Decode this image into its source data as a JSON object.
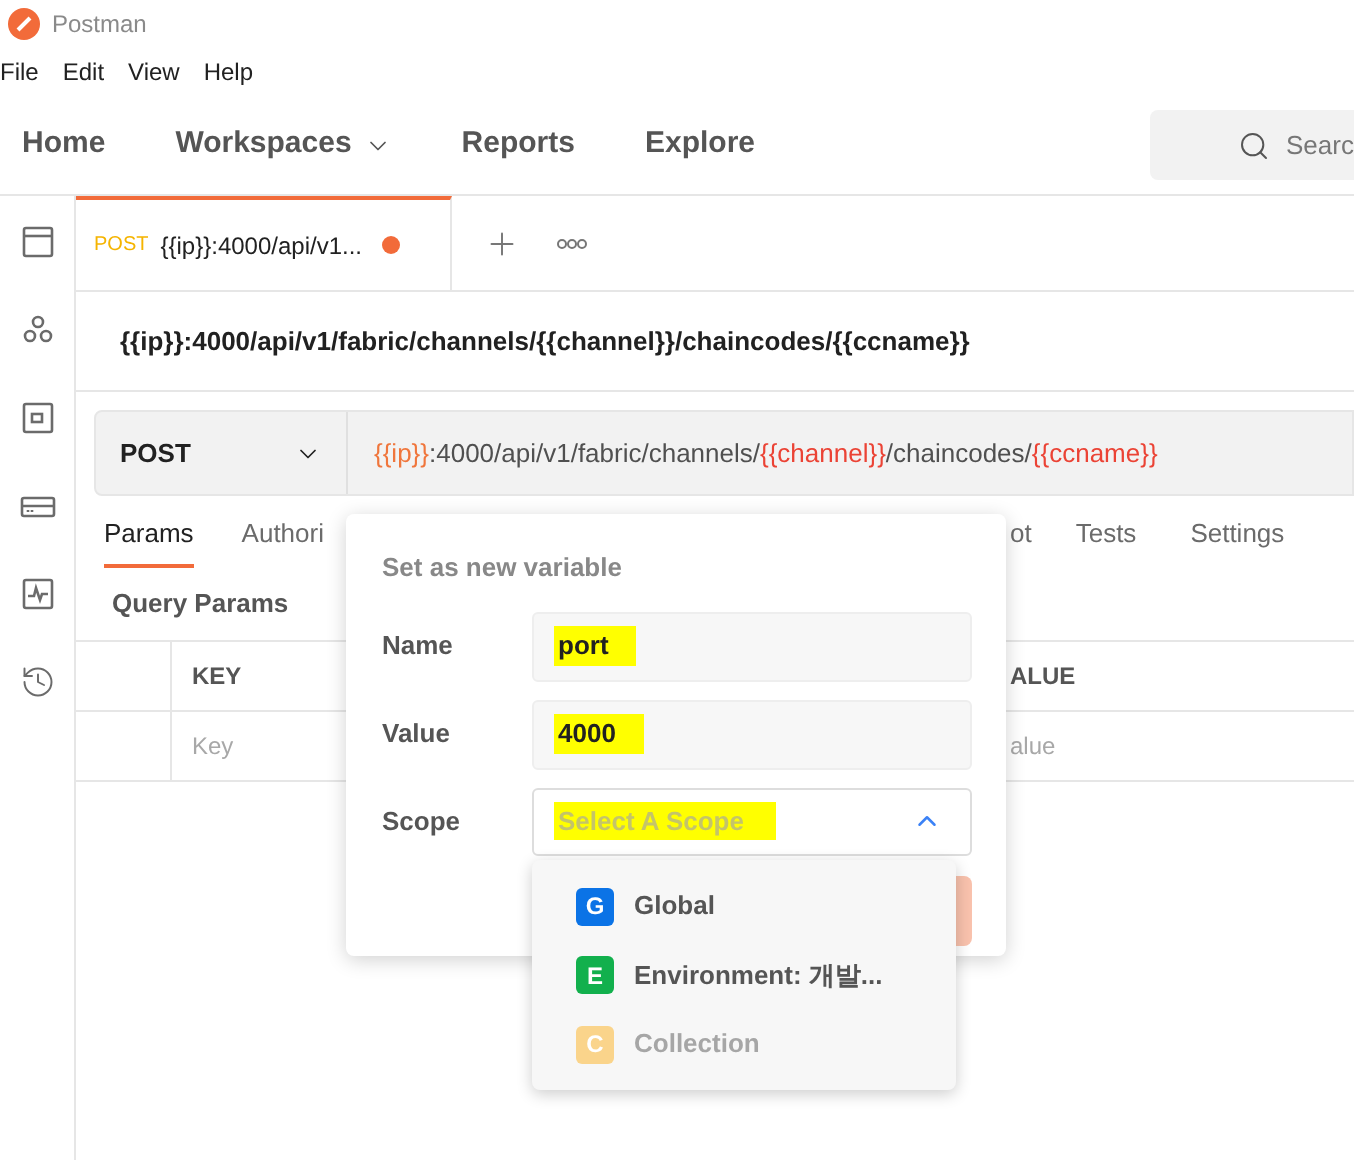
{
  "app": {
    "title": "Postman"
  },
  "menu": [
    "File",
    "Edit",
    "View",
    "Help"
  ],
  "nav": [
    {
      "label": "Home",
      "dropdown": false
    },
    {
      "label": "Workspaces",
      "dropdown": true
    },
    {
      "label": "Reports",
      "dropdown": false
    },
    {
      "label": "Explore",
      "dropdown": false
    }
  ],
  "search": {
    "placeholder": "Searc"
  },
  "request_tabs": [
    {
      "method": "POST",
      "title": "{{ip}}:4000/api/v1...",
      "unsaved": true,
      "selected": true
    }
  ],
  "request_title": "{{ip}}:4000/api/v1/fabric/channels/{{channel}}/chaincodes/{{ccname}}",
  "url_bar": {
    "method": "POST",
    "url_parts": [
      {
        "text": "{{ip}}",
        "kind": "variable",
        "color": "#f0763c"
      },
      {
        "text": ":4000/api/v1/fabric/channels/",
        "kind": "text"
      },
      {
        "text": "{{channel}}",
        "kind": "variable",
        "color": "#eb4335"
      },
      {
        "text": "/chaincodes/",
        "kind": "text"
      },
      {
        "text": "{{ccname}}",
        "kind": "variable",
        "color": "#eb4335"
      }
    ]
  },
  "request_sections": [
    {
      "label": "Params",
      "selected": true
    },
    {
      "label": "Authori",
      "selected": false
    },
    {
      "label": "ot",
      "selected": false
    },
    {
      "label": "Tests",
      "selected": false
    },
    {
      "label": "Settings",
      "selected": false
    }
  ],
  "sub_tab": "Query Params",
  "params_table": {
    "columns": [
      "KEY",
      "ALUE"
    ],
    "placeholders": [
      "Key",
      "alue"
    ]
  },
  "popup": {
    "title": "Set as new variable",
    "fields": [
      {
        "label": "Name",
        "value": "port",
        "highlighted": true
      },
      {
        "label": "Value",
        "value": "4000",
        "highlighted": true
      }
    ],
    "scope": {
      "label": "Scope",
      "placeholder": "Select A Scope",
      "highlighted": true,
      "expanded": true
    },
    "options": [
      {
        "badge": "G",
        "label": "Global",
        "color": "#0b73e6",
        "disabled": false
      },
      {
        "badge": "E",
        "label": "Environment: 개발...",
        "color": "#12b04d",
        "disabled": false
      },
      {
        "badge": "C",
        "label": "Collection",
        "color": "#fad48b",
        "disabled": true
      }
    ]
  }
}
